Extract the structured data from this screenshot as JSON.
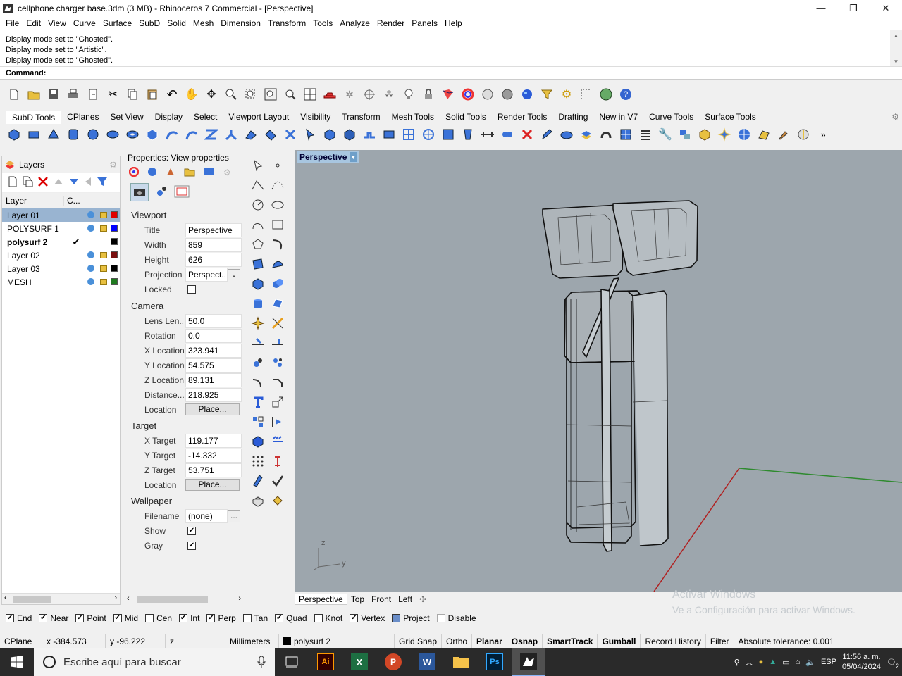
{
  "window": {
    "title": "cellphone charger base.3dm (3 MB) - Rhinoceros 7 Commercial - [Perspective]"
  },
  "menu": [
    "File",
    "Edit",
    "View",
    "Curve",
    "Surface",
    "SubD",
    "Solid",
    "Mesh",
    "Dimension",
    "Transform",
    "Tools",
    "Analyze",
    "Render",
    "Panels",
    "Help"
  ],
  "history": [
    "Display mode set to \"Ghosted\".",
    "Display mode set to \"Artistic\".",
    "Display mode set to \"Ghosted\"."
  ],
  "command": {
    "label": "Command:",
    "value": ""
  },
  "toolbar_tabs": [
    "SubD Tools",
    "CPlanes",
    "Set View",
    "Display",
    "Select",
    "Viewport Layout",
    "Visibility",
    "Transform",
    "Mesh Tools",
    "Solid Tools",
    "Render Tools",
    "Drafting",
    "New in V7",
    "Curve Tools",
    "Surface Tools"
  ],
  "layers_panel": {
    "title": "Layers",
    "col_layer": "Layer",
    "col_c": "C...",
    "rows": [
      {
        "name": "Layer 01",
        "color": "#e00000",
        "current": false,
        "selected": true
      },
      {
        "name": "POLYSURF 1",
        "color": "#0000ff",
        "current": false,
        "selected": false
      },
      {
        "name": "polysurf 2",
        "color": "#000000",
        "current": true,
        "selected": false
      },
      {
        "name": "Layer 02",
        "color": "#7a1010",
        "current": false,
        "selected": false
      },
      {
        "name": "Layer 03",
        "color": "#000000",
        "current": false,
        "selected": false
      },
      {
        "name": "MESH",
        "color": "#1f7a1f",
        "current": false,
        "selected": false
      }
    ]
  },
  "properties": {
    "title": "Properties: View properties",
    "viewport_section": "Viewport",
    "viewport": [
      {
        "label": "Title",
        "value": "Perspective"
      },
      {
        "label": "Width",
        "value": "859"
      },
      {
        "label": "Height",
        "value": "626"
      },
      {
        "label": "Projection",
        "value": "Perspect..."
      }
    ],
    "locked_label": "Locked",
    "camera_section": "Camera",
    "camera": [
      {
        "label": "Lens Len...",
        "value": "50.0"
      },
      {
        "label": "Rotation",
        "value": "0.0"
      },
      {
        "label": "X Location",
        "value": "323.941"
      },
      {
        "label": "Y Location",
        "value": "54.575"
      },
      {
        "label": "Z Location",
        "value": "89.131"
      },
      {
        "label": "Distance...",
        "value": "218.925"
      }
    ],
    "location_label": "Location",
    "place_button": "Place...",
    "target_section": "Target",
    "target": [
      {
        "label": "X Target",
        "value": "119.177"
      },
      {
        "label": "Y Target",
        "value": "-14.332"
      },
      {
        "label": "Z Target",
        "value": "53.751"
      }
    ],
    "wallpaper_section": "Wallpaper",
    "filename_label": "Filename",
    "filename_value": "(none)",
    "browse_button": "...",
    "show_label": "Show",
    "gray_label": "Gray"
  },
  "viewport": {
    "label": "Perspective",
    "tabs": [
      "Perspective",
      "Top",
      "Front",
      "Left"
    ],
    "axis_z": "z",
    "axis_y": "y",
    "watermark_title": "Activar Windows",
    "watermark_sub": "Ve a Configuración para activar Windows."
  },
  "osnaps": [
    {
      "label": "End",
      "checked": true
    },
    {
      "label": "Near",
      "checked": true
    },
    {
      "label": "Point",
      "checked": true
    },
    {
      "label": "Mid",
      "checked": true
    },
    {
      "label": "Cen",
      "checked": false
    },
    {
      "label": "Int",
      "checked": true
    },
    {
      "label": "Perp",
      "checked": true
    },
    {
      "label": "Tan",
      "checked": false
    },
    {
      "label": "Quad",
      "checked": true
    },
    {
      "label": "Knot",
      "checked": false
    },
    {
      "label": "Vertex",
      "checked": true
    },
    {
      "label": "Project",
      "checked": false
    },
    {
      "label": "Disable",
      "checked": false
    }
  ],
  "status": {
    "cplane": "CPlane",
    "x": "x -384.573",
    "y": "y -96.222",
    "z": "z",
    "units": "Millimeters",
    "layer": "polysurf 2",
    "grid_snap": "Grid Snap",
    "ortho": "Ortho",
    "planar": "Planar",
    "osnap": "Osnap",
    "smarttrack": "SmartTrack",
    "gumball": "Gumball",
    "record_history": "Record History",
    "filter": "Filter",
    "tolerance": "Absolute tolerance: 0.001"
  },
  "taskbar": {
    "search_placeholder": "Escribe aquí para buscar",
    "language": "ESP",
    "time": "11:56 a. m.",
    "date": "05/04/2024",
    "notifications": "2"
  }
}
